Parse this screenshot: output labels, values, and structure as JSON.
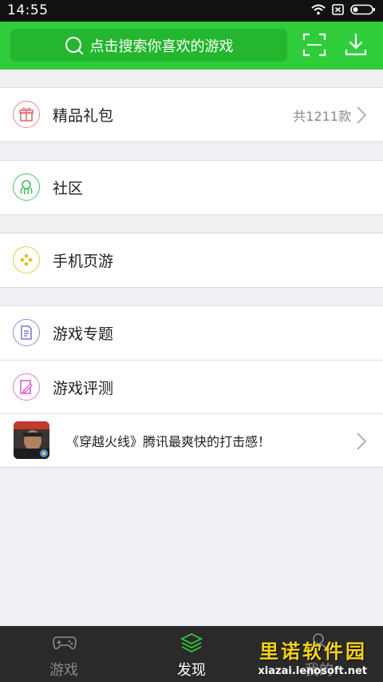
{
  "status": {
    "time": "14:55"
  },
  "header": {
    "search_placeholder": "点击搜索你喜欢的游戏",
    "accent_color": "#2fcd3a"
  },
  "list": {
    "gift": {
      "label": "精品礼包",
      "count": "共1211款"
    },
    "community": {
      "label": "社区"
    },
    "mobile_web_games": {
      "label": "手机页游"
    },
    "topics": {
      "label": "游戏专题"
    },
    "reviews": {
      "label": "游戏评测"
    },
    "promo": {
      "text": "《穿越火线》腾讯最爽快的打击感！"
    }
  },
  "tabbar": {
    "tabs": [
      {
        "label": "游戏",
        "active": false
      },
      {
        "label": "发现",
        "active": true
      },
      {
        "label": "我的",
        "active": false
      }
    ]
  },
  "watermark": {
    "title": "里诺软件园",
    "url": "xiazai.lenosoft.net"
  }
}
